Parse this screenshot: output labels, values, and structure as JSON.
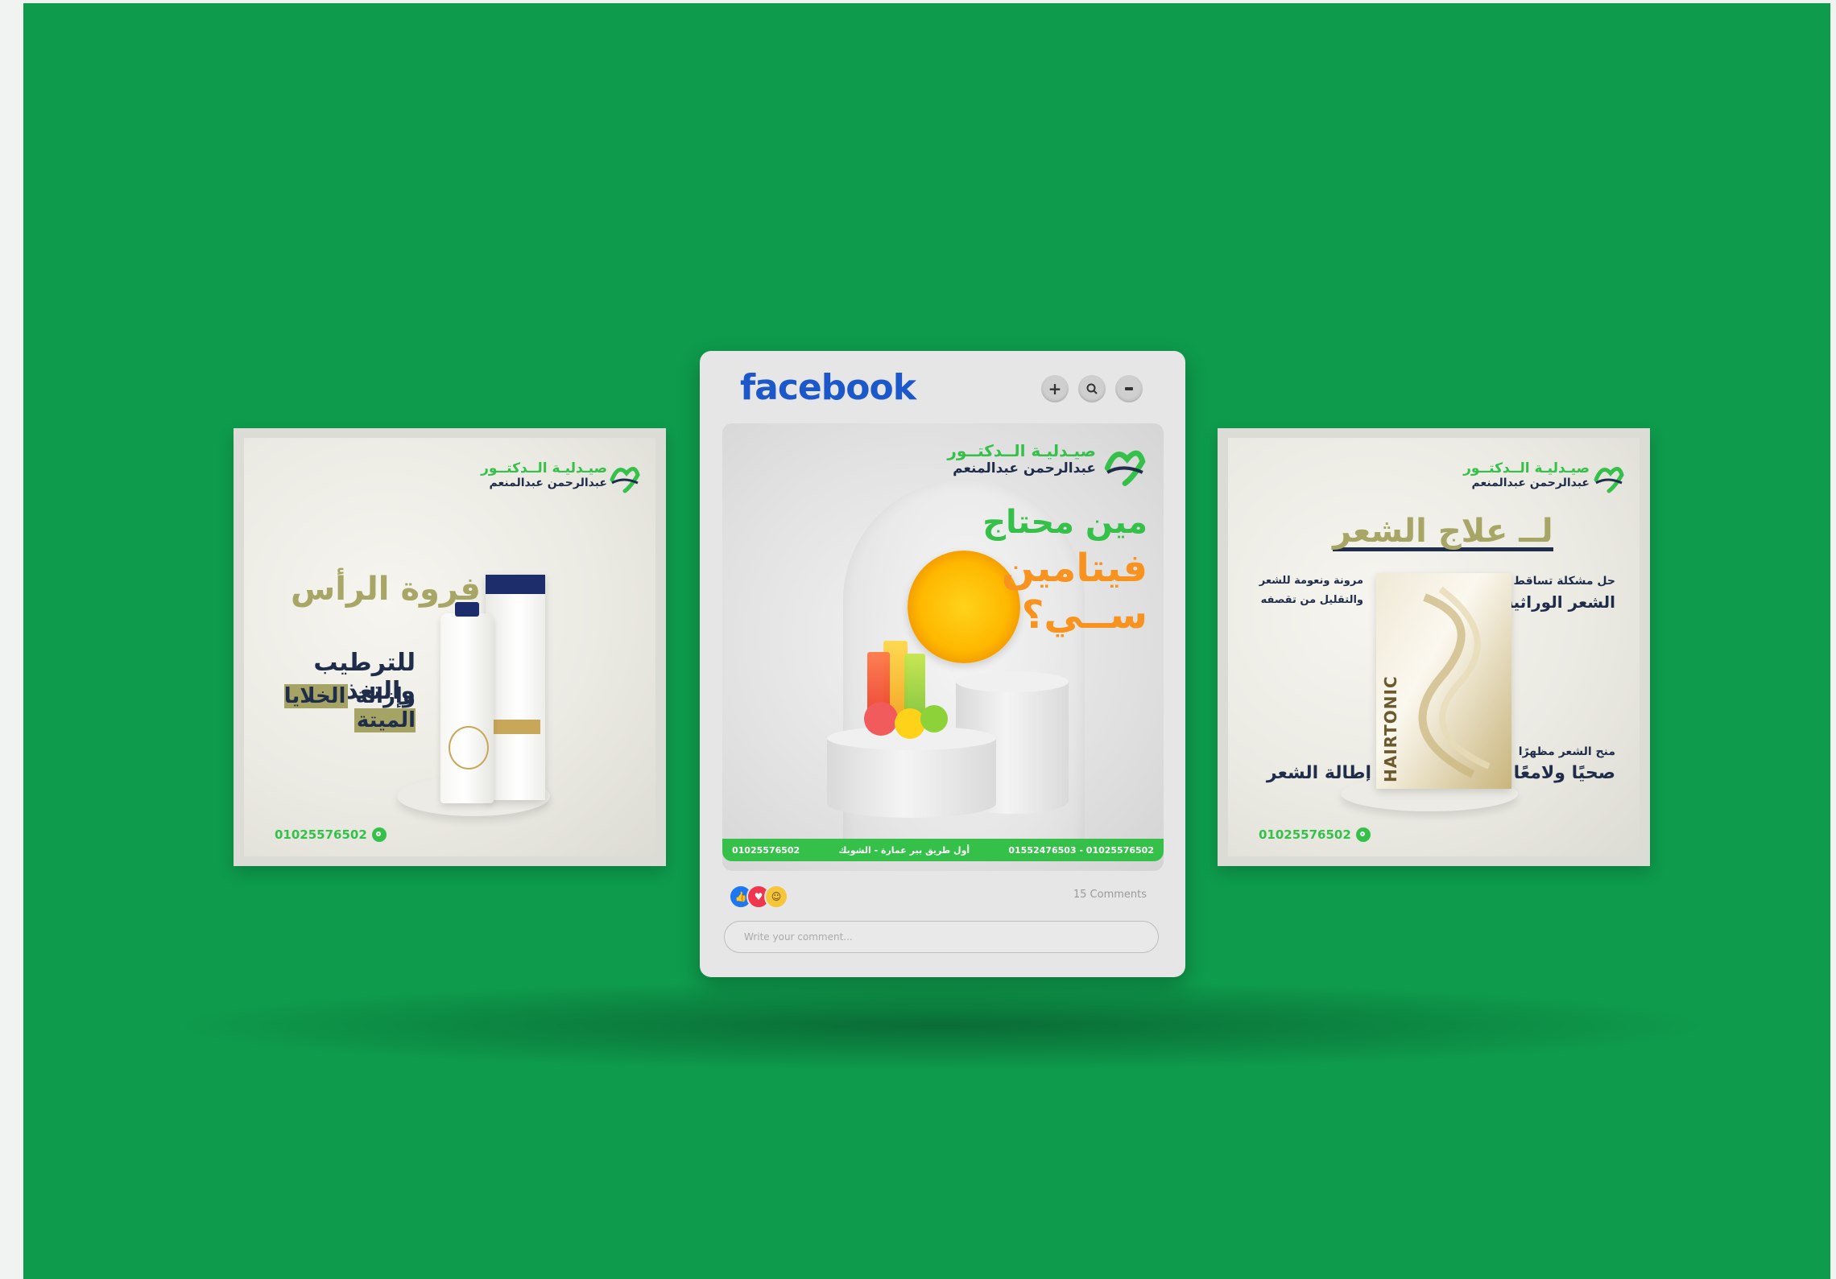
{
  "colors": {
    "background": "#0e9b4c",
    "brand_green": "#35c04a",
    "navy": "#1f2d4a",
    "olive": "#a7a666",
    "facebook_blue": "#1c58c9",
    "orange": "#f7931e"
  },
  "brand": {
    "line1": "صيـدليـة الــدكتــور",
    "line2": "عبدالرحمن عبدالمنعم"
  },
  "left_post": {
    "headline": "لــ فروة الرأس",
    "line1": "للترطيب والتغذية",
    "line2_prefix": "وإزالة",
    "line2_highlight": "الخلايا الميتة",
    "phone": "01025576502"
  },
  "center_post": {
    "app_name": "facebook",
    "header_buttons": {
      "add_icon": "+",
      "search_icon": "search-icon",
      "menu_icon": "menu-icon"
    },
    "title_line1": "مين محتاج",
    "title_line2": "فيتامين",
    "title_line3": "ســي؟",
    "footer_phone": "01025576502",
    "footer_address": "أول طريق بير عمارة - الشوبك",
    "footer_phones": "01552476503 - 01025576502",
    "comments": "15 Comments",
    "comment_placeholder": "Write your comment..."
  },
  "right_post": {
    "headline": "لــ علاج الشعر",
    "left_top_1": "مرونة ونعومة للشعر",
    "left_top_2": "والتقليل من تقصفه",
    "right_top_1": "حل مشكلة تساقط",
    "right_top_2": "الشعر الوراثية",
    "left_bottom": "إطالة الشعر",
    "right_bottom_1": "منح الشعر مظهرًا",
    "right_bottom_2": "صحيًا ولامعًا",
    "product_name": "HAIRTONIC",
    "phone": "01025576502"
  }
}
